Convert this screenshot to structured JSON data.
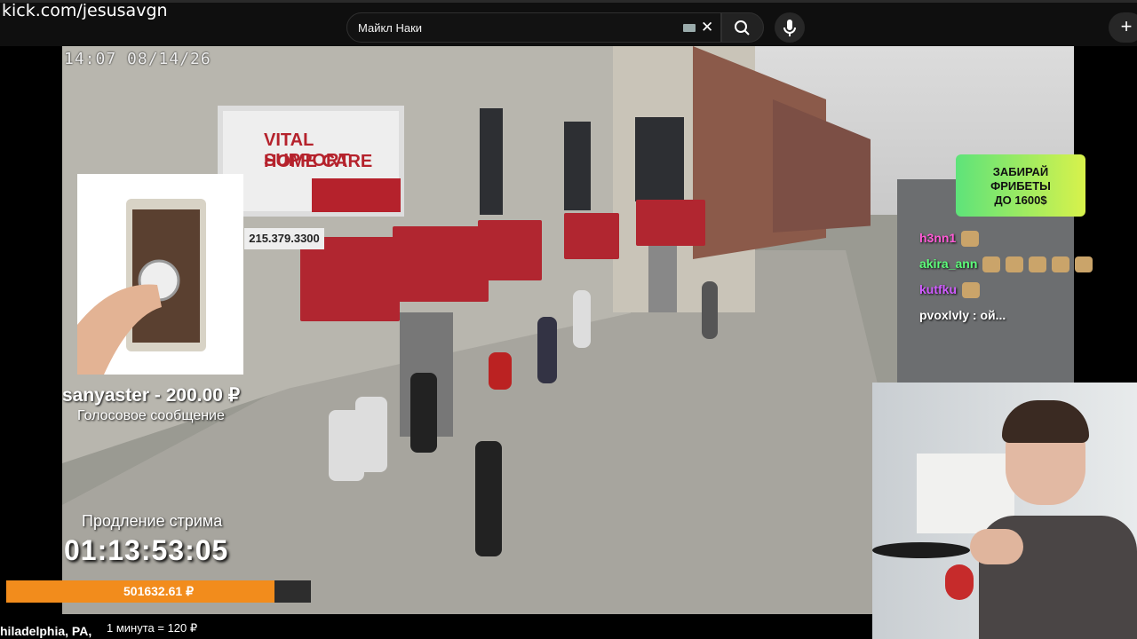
{
  "browser": {
    "url": "kick.com/jesusavgn",
    "search_query": "Майкл Наки",
    "icons": [
      "keyboard-icon",
      "clear-icon",
      "search-icon",
      "mic-icon",
      "plus-icon"
    ],
    "new_button_label": "+"
  },
  "stream": {
    "camera_timestamp": "14:07  08/14/26",
    "sign_line1": "VITAL SUPPORT",
    "sign_line2": "HOME CARE",
    "sign_phone": "215.379.3300",
    "donation": {
      "donor": "sanyaster - 200.00 ₽",
      "type": "Голосовое сообщение"
    },
    "extension_label": "Продление стрима",
    "timer": "01:13:53:05",
    "progress_value": "501632.61 ₽",
    "progress_fraction": 0.88,
    "location": "hiladelphia, PA,",
    "rate": "1 минута = 120 ₽"
  },
  "promo": {
    "line1": "ЗАБИРАЙ",
    "line2": "ФРИБЕТЫ",
    "line3": "ДО 1600$",
    "colors": [
      "#5ee37a",
      "#d8f24b"
    ]
  },
  "chat": [
    {
      "user": "h3nn1",
      "text": "",
      "color": "#ff5ad5",
      "emotes": 1
    },
    {
      "user": "akira_ann",
      "text": "",
      "color": "#5dff7a",
      "emotes": 5
    },
    {
      "user": "kutfku",
      "text": "",
      "color": "#d05cff",
      "emotes": 1
    },
    {
      "user": "pvoxlvly",
      "text": " : ой...",
      "color": "#ffffff",
      "emotes": 0
    }
  ]
}
